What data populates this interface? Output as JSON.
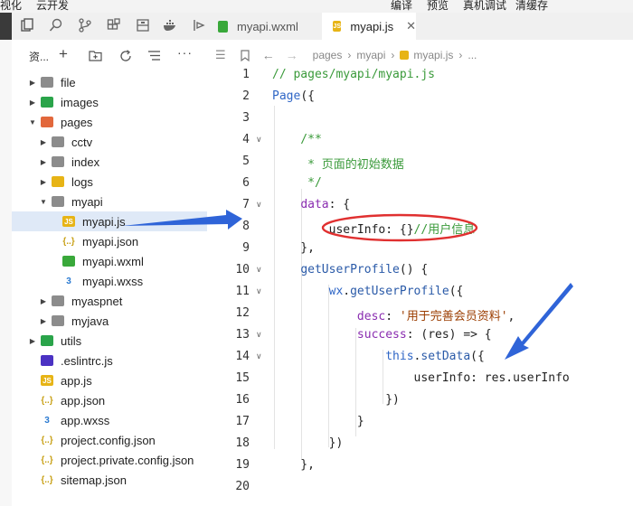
{
  "menu": [
    "视化",
    "云开发",
    "编译",
    "预览",
    "真机调试",
    "清缓存"
  ],
  "tabs": [
    {
      "label": "myapi.wxml",
      "icon": "wxml-file-icon",
      "active": false
    },
    {
      "label": "myapi.js",
      "icon": "js-file-icon",
      "active": true
    }
  ],
  "explorer": {
    "title": "资...",
    "tree": [
      {
        "label": "file",
        "depth": 0,
        "type": "folder",
        "open": false
      },
      {
        "label": "images",
        "depth": 0,
        "type": "folder-img",
        "open": false
      },
      {
        "label": "pages",
        "depth": 0,
        "type": "folder-pages",
        "open": true
      },
      {
        "label": "cctv",
        "depth": 1,
        "type": "folder",
        "open": false
      },
      {
        "label": "index",
        "depth": 1,
        "type": "folder",
        "open": false
      },
      {
        "label": "logs",
        "depth": 1,
        "type": "folder-logs",
        "open": false
      },
      {
        "label": "myapi",
        "depth": 1,
        "type": "folder",
        "open": true
      },
      {
        "label": "myapi.js",
        "depth": 2,
        "type": "js",
        "selected": true
      },
      {
        "label": "myapi.json",
        "depth": 2,
        "type": "json"
      },
      {
        "label": "myapi.wxml",
        "depth": 2,
        "type": "wxml"
      },
      {
        "label": "myapi.wxss",
        "depth": 2,
        "type": "wxss"
      },
      {
        "label": "myaspnet",
        "depth": 1,
        "type": "folder",
        "open": false
      },
      {
        "label": "myjava",
        "depth": 1,
        "type": "folder",
        "open": false
      },
      {
        "label": "utils",
        "depth": 0,
        "type": "folder-utils",
        "open": false
      },
      {
        "label": ".eslintrc.js",
        "depth": 0,
        "type": "eslint"
      },
      {
        "label": "app.js",
        "depth": 0,
        "type": "js"
      },
      {
        "label": "app.json",
        "depth": 0,
        "type": "json"
      },
      {
        "label": "app.wxss",
        "depth": 0,
        "type": "wxss"
      },
      {
        "label": "project.config.json",
        "depth": 0,
        "type": "json"
      },
      {
        "label": "project.private.config.json",
        "depth": 0,
        "type": "json"
      },
      {
        "label": "sitemap.json",
        "depth": 0,
        "type": "json"
      }
    ]
  },
  "breadcrumb": [
    "pages",
    "myapi",
    "myapi.js",
    "..."
  ],
  "code": {
    "line_numbers": [
      "1",
      "2",
      "3",
      "4",
      "5",
      "6",
      "7",
      "8",
      "9",
      "10",
      "11",
      "12",
      "13",
      "14",
      "15",
      "16",
      "17",
      "18",
      "19",
      "20"
    ],
    "lines": [
      "// pages/myapi/myapi.js",
      "Page({",
      "",
      "    /**",
      "     * 页面的初始数据",
      "     */",
      "    data: {",
      "        userInfo: {}//用户信息",
      "    },",
      "    getUserProfile() {",
      "        wx.getUserProfile({",
      "            desc: '用于完善会员资料',",
      "            success: (res) => {",
      "                this.setData({",
      "                    userInfo: res.userInfo",
      "                })",
      "            }",
      "        })",
      "    },",
      ""
    ]
  },
  "colors": {
    "accent": "#2f66c6",
    "annotation_arrow": "#2f64d8",
    "annotation_circle": "#e03030",
    "selection": "#dfe9f7"
  }
}
